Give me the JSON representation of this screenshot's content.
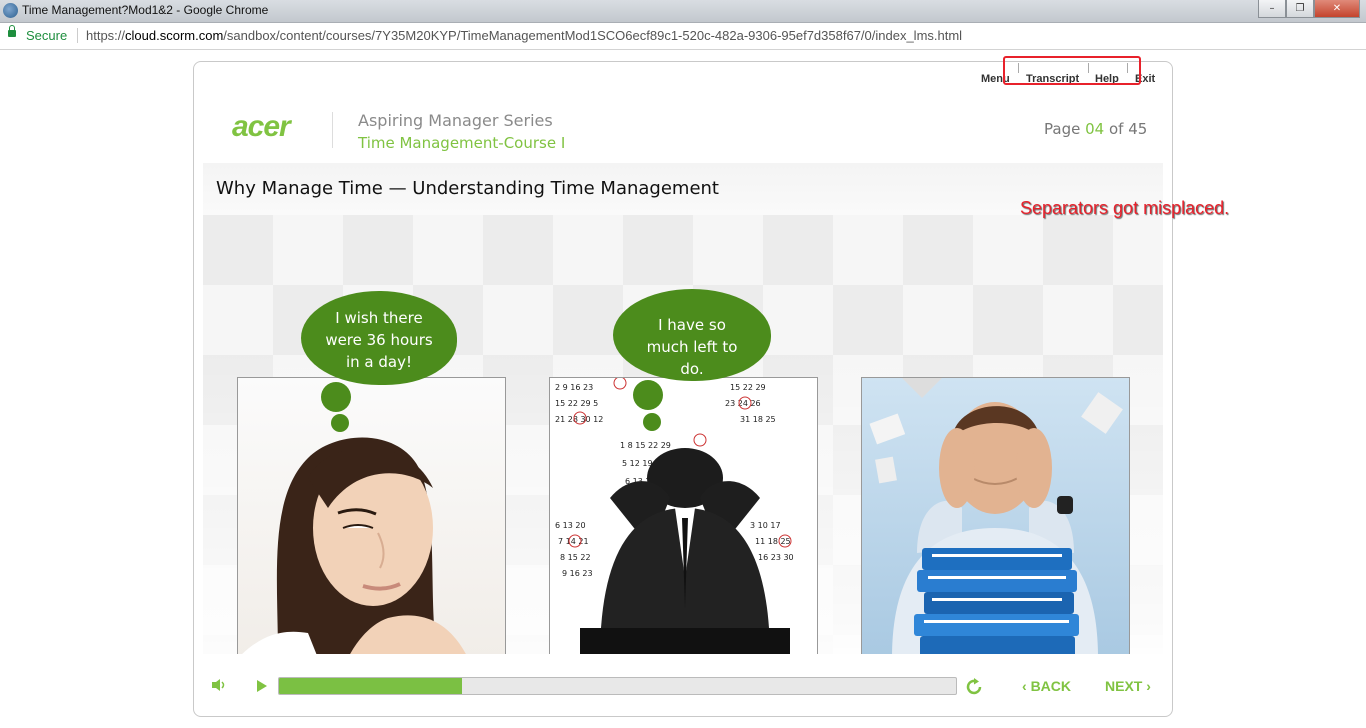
{
  "window": {
    "title": "Time Management?Mod1&2 - Google Chrome",
    "buttons": {
      "minimize": "–",
      "maximize": "❐",
      "close": "✕"
    }
  },
  "address": {
    "secure_label": "Secure",
    "url_scheme": "https://",
    "url_host": "cloud.scorm.com",
    "url_path": "/sandbox/content/courses/7Y35M20KYP/TimeManagementMod1SCO6ecf89c1-520c-482a-9306-95ef7d358f67/0/index_lms.html"
  },
  "course": {
    "nav": {
      "menu": "Menu",
      "transcript": "Transcript",
      "help": "Help",
      "exit": "Exit"
    },
    "logo": "acer",
    "series": "Aspiring Manager Series",
    "course_title": "Time Management-Course I",
    "page": {
      "prefix": "Page",
      "current": "04",
      "of": "of 45"
    },
    "heading": "Why Manage Time — Understanding Time Management",
    "bubbles": {
      "b1": "I wish there were 36 hours in a day!",
      "b2": "I have so much left to do."
    },
    "player": {
      "back": "BACK",
      "next": "NEXT",
      "progress_fraction": 0.27
    }
  },
  "annotation": {
    "text": "Separators got misplaced."
  },
  "colors": {
    "accent_green": "#80c342",
    "bubble_green": "#4c8c1c",
    "annotation_red": "#e8212b"
  },
  "icons": [
    "chrome-icon",
    "lock-icon",
    "speaker-icon",
    "play-icon",
    "replay-icon",
    "chevron-left-icon",
    "chevron-right-icon"
  ]
}
